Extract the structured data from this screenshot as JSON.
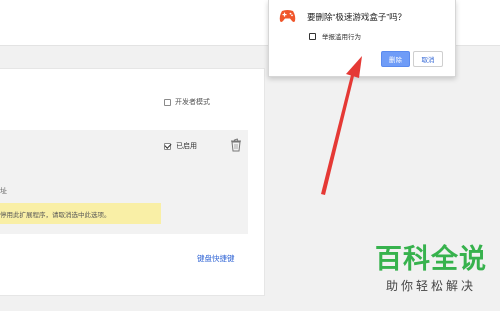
{
  "settings": {
    "developer_mode_label": "开发者模式",
    "enabled_label": "已启用",
    "address_text": "址",
    "warning_text": "停用此扩展程序，请取消选中此选项。",
    "keyboard_shortcuts_link": "键盘快捷键"
  },
  "dialog": {
    "title": "要删除“极速游戏盒子”吗？",
    "report_label": "举报滥用行为",
    "report_checked": false,
    "delete_button": "删除",
    "cancel_button": "取消",
    "icon": "gamepad-icon"
  },
  "watermark": {
    "main": "百科全说",
    "sub": "助你轻松解决"
  },
  "colors": {
    "accent_blue": "#6f9cf7",
    "link_blue": "#3367d6",
    "warning_yellow": "#f9efa6",
    "arrow_red": "#e53935",
    "gamepad_orange": "#f0562b",
    "watermark_green": "#37b24d"
  }
}
